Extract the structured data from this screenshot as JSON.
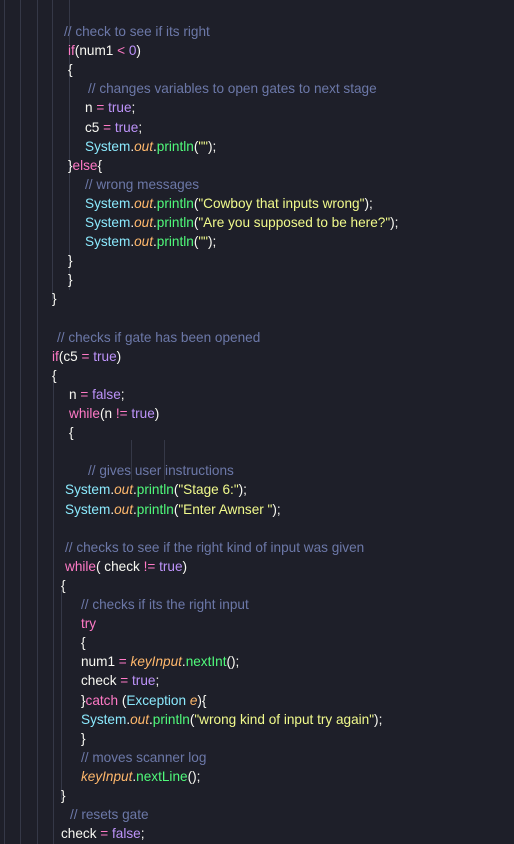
{
  "editor": {
    "colors": {
      "background": "#1e1f29",
      "comment": "#6c78a8",
      "keyword": "#ff7ac6",
      "number": "#bd93f9",
      "class": "#8be9fd",
      "field": "#ffb86c",
      "method": "#50fa7b",
      "string": "#f1fa8c",
      "text": "#f8f8f2"
    },
    "lines": [
      {
        "indent": 64,
        "tokens": [
          {
            "t": "comment",
            "s": "// check to see if its right"
          }
        ]
      },
      {
        "indent": 68,
        "tokens": [
          {
            "t": "keyword",
            "s": "if"
          },
          {
            "t": "plain",
            "s": "(num1 "
          },
          {
            "t": "op",
            "s": "<"
          },
          {
            "t": "plain",
            "s": " "
          },
          {
            "t": "number",
            "s": "0"
          },
          {
            "t": "plain",
            "s": ")"
          }
        ]
      },
      {
        "indent": 68,
        "tokens": [
          {
            "t": "plain",
            "s": "{"
          }
        ]
      },
      {
        "indent": 88,
        "tokens": [
          {
            "t": "comment",
            "s": "// changes variables to open gates to next stage"
          }
        ]
      },
      {
        "indent": 85,
        "tokens": [
          {
            "t": "plain",
            "s": "n "
          },
          {
            "t": "op",
            "s": "="
          },
          {
            "t": "plain",
            "s": " "
          },
          {
            "t": "bool",
            "s": "true"
          },
          {
            "t": "plain",
            "s": ";"
          }
        ]
      },
      {
        "indent": 85,
        "tokens": [
          {
            "t": "plain",
            "s": "c5 "
          },
          {
            "t": "op",
            "s": "="
          },
          {
            "t": "plain",
            "s": " "
          },
          {
            "t": "bool",
            "s": "true"
          },
          {
            "t": "plain",
            "s": ";"
          }
        ]
      },
      {
        "indent": 85,
        "tokens": [
          {
            "t": "class",
            "s": "System"
          },
          {
            "t": "plain",
            "s": "."
          },
          {
            "t": "field",
            "s": "out"
          },
          {
            "t": "plain",
            "s": "."
          },
          {
            "t": "method",
            "s": "println"
          },
          {
            "t": "plain",
            "s": "("
          },
          {
            "t": "string",
            "s": "\"\""
          },
          {
            "t": "plain",
            "s": ");"
          }
        ]
      },
      {
        "indent": 68,
        "tokens": [
          {
            "t": "plain",
            "s": "}"
          },
          {
            "t": "keyword",
            "s": "else"
          },
          {
            "t": "plain",
            "s": "{"
          }
        ]
      },
      {
        "indent": 85,
        "tokens": [
          {
            "t": "comment",
            "s": "// wrong messages"
          }
        ]
      },
      {
        "indent": 85,
        "tokens": [
          {
            "t": "class",
            "s": "System"
          },
          {
            "t": "plain",
            "s": "."
          },
          {
            "t": "field",
            "s": "out"
          },
          {
            "t": "plain",
            "s": "."
          },
          {
            "t": "method",
            "s": "println"
          },
          {
            "t": "plain",
            "s": "("
          },
          {
            "t": "string",
            "s": "\"Cowboy that inputs wrong\""
          },
          {
            "t": "plain",
            "s": ");"
          }
        ]
      },
      {
        "indent": 85,
        "tokens": [
          {
            "t": "class",
            "s": "System"
          },
          {
            "t": "plain",
            "s": "."
          },
          {
            "t": "field",
            "s": "out"
          },
          {
            "t": "plain",
            "s": "."
          },
          {
            "t": "method",
            "s": "println"
          },
          {
            "t": "plain",
            "s": "("
          },
          {
            "t": "string",
            "s": "\"Are you supposed to be here?\""
          },
          {
            "t": "plain",
            "s": ");"
          }
        ]
      },
      {
        "indent": 85,
        "tokens": [
          {
            "t": "class",
            "s": "System"
          },
          {
            "t": "plain",
            "s": "."
          },
          {
            "t": "field",
            "s": "out"
          },
          {
            "t": "plain",
            "s": "."
          },
          {
            "t": "method",
            "s": "println"
          },
          {
            "t": "plain",
            "s": "("
          },
          {
            "t": "string",
            "s": "\"\""
          },
          {
            "t": "plain",
            "s": ");"
          }
        ]
      },
      {
        "indent": 68,
        "tokens": [
          {
            "t": "plain",
            "s": "}"
          }
        ]
      },
      {
        "indent": 68,
        "tokens": [
          {
            "t": "plain",
            "s": "}"
          }
        ]
      },
      {
        "indent": 52,
        "tokens": [
          {
            "t": "plain",
            "s": "}"
          }
        ]
      },
      {
        "indent": 0,
        "tokens": []
      },
      {
        "indent": 57,
        "tokens": [
          {
            "t": "comment",
            "s": "// checks if gate has been opened"
          }
        ]
      },
      {
        "indent": 52,
        "tokens": [
          {
            "t": "keyword",
            "s": "if"
          },
          {
            "t": "plain",
            "s": "(c5 "
          },
          {
            "t": "op",
            "s": "="
          },
          {
            "t": "plain",
            "s": " "
          },
          {
            "t": "bool",
            "s": "true"
          },
          {
            "t": "plain",
            "s": ")"
          }
        ]
      },
      {
        "indent": 52,
        "tokens": [
          {
            "t": "plain",
            "s": "{"
          }
        ]
      },
      {
        "indent": 69,
        "tokens": [
          {
            "t": "plain",
            "s": "n "
          },
          {
            "t": "op",
            "s": "="
          },
          {
            "t": "plain",
            "s": " "
          },
          {
            "t": "bool",
            "s": "false"
          },
          {
            "t": "plain",
            "s": ";"
          }
        ]
      },
      {
        "indent": 69,
        "tokens": [
          {
            "t": "keyword",
            "s": "while"
          },
          {
            "t": "plain",
            "s": "(n "
          },
          {
            "t": "op",
            "s": "!="
          },
          {
            "t": "plain",
            "s": " "
          },
          {
            "t": "bool",
            "s": "true"
          },
          {
            "t": "plain",
            "s": ")"
          }
        ]
      },
      {
        "indent": 69,
        "tokens": [
          {
            "t": "plain",
            "s": "{"
          }
        ]
      },
      {
        "indent": 0,
        "tokens": []
      },
      {
        "indent": 88,
        "tokens": [
          {
            "t": "comment",
            "s": "// gives user instructions"
          }
        ]
      },
      {
        "indent": 65,
        "tokens": [
          {
            "t": "class",
            "s": "System"
          },
          {
            "t": "plain",
            "s": "."
          },
          {
            "t": "field",
            "s": "out"
          },
          {
            "t": "plain",
            "s": "."
          },
          {
            "t": "method",
            "s": "println"
          },
          {
            "t": "plain",
            "s": "("
          },
          {
            "t": "string",
            "s": "\"Stage 6:\""
          },
          {
            "t": "plain",
            "s": ");"
          }
        ]
      },
      {
        "indent": 65,
        "tokens": [
          {
            "t": "class",
            "s": "System"
          },
          {
            "t": "plain",
            "s": "."
          },
          {
            "t": "field",
            "s": "out"
          },
          {
            "t": "plain",
            "s": "."
          },
          {
            "t": "method",
            "s": "println"
          },
          {
            "t": "plain",
            "s": "("
          },
          {
            "t": "string",
            "s": "\"Enter Awnser \""
          },
          {
            "t": "plain",
            "s": ");"
          }
        ]
      },
      {
        "indent": 0,
        "tokens": []
      },
      {
        "indent": 65,
        "tokens": [
          {
            "t": "comment",
            "s": "// checks to see if the right kind of input was given"
          }
        ]
      },
      {
        "indent": 65,
        "tokens": [
          {
            "t": "keyword",
            "s": "while"
          },
          {
            "t": "plain",
            "s": "( check "
          },
          {
            "t": "op",
            "s": "!="
          },
          {
            "t": "plain",
            "s": " "
          },
          {
            "t": "bool",
            "s": "true"
          },
          {
            "t": "plain",
            "s": ")"
          }
        ]
      },
      {
        "indent": 61,
        "tokens": [
          {
            "t": "plain",
            "s": "{"
          }
        ]
      },
      {
        "indent": 81,
        "tokens": [
          {
            "t": "comment",
            "s": "// checks if its the right input"
          }
        ]
      },
      {
        "indent": 81,
        "tokens": [
          {
            "t": "keyword",
            "s": "try"
          }
        ]
      },
      {
        "indent": 81,
        "tokens": [
          {
            "t": "plain",
            "s": "{"
          }
        ]
      },
      {
        "indent": 81,
        "tokens": [
          {
            "t": "plain",
            "s": "num1 "
          },
          {
            "t": "op",
            "s": "="
          },
          {
            "t": "plain",
            "s": " "
          },
          {
            "t": "field",
            "s": "keyInput"
          },
          {
            "t": "plain",
            "s": "."
          },
          {
            "t": "method",
            "s": "nextInt"
          },
          {
            "t": "plain",
            "s": "();"
          }
        ]
      },
      {
        "indent": 81,
        "tokens": [
          {
            "t": "plain",
            "s": "check "
          },
          {
            "t": "op",
            "s": "="
          },
          {
            "t": "plain",
            "s": " "
          },
          {
            "t": "bool",
            "s": "true"
          },
          {
            "t": "plain",
            "s": ";"
          }
        ]
      },
      {
        "indent": 81,
        "tokens": [
          {
            "t": "plain",
            "s": "}"
          },
          {
            "t": "keyword",
            "s": "catch"
          },
          {
            "t": "plain",
            "s": " ("
          },
          {
            "t": "class",
            "s": "Exception"
          },
          {
            "t": "plain",
            "s": " "
          },
          {
            "t": "field",
            "s": "e"
          },
          {
            "t": "plain",
            "s": "){"
          }
        ]
      },
      {
        "indent": 81,
        "tokens": [
          {
            "t": "class",
            "s": "System"
          },
          {
            "t": "plain",
            "s": "."
          },
          {
            "t": "field",
            "s": "out"
          },
          {
            "t": "plain",
            "s": "."
          },
          {
            "t": "method",
            "s": "println"
          },
          {
            "t": "plain",
            "s": "("
          },
          {
            "t": "string",
            "s": "\"wrong kind of input try again\""
          },
          {
            "t": "plain",
            "s": ");"
          }
        ]
      },
      {
        "indent": 81,
        "tokens": [
          {
            "t": "plain",
            "s": "}"
          }
        ]
      },
      {
        "indent": 81,
        "tokens": [
          {
            "t": "comment",
            "s": "// moves scanner log"
          }
        ]
      },
      {
        "indent": 81,
        "tokens": [
          {
            "t": "field",
            "s": "keyInput"
          },
          {
            "t": "plain",
            "s": "."
          },
          {
            "t": "method",
            "s": "nextLine"
          },
          {
            "t": "plain",
            "s": "();"
          }
        ]
      },
      {
        "indent": 61,
        "tokens": [
          {
            "t": "plain",
            "s": "}"
          }
        ]
      },
      {
        "indent": 70,
        "tokens": [
          {
            "t": "comment",
            "s": "// resets gate"
          }
        ]
      },
      {
        "indent": 61,
        "tokens": [
          {
            "t": "plain",
            "s": "check "
          },
          {
            "t": "op",
            "s": "="
          },
          {
            "t": "plain",
            "s": " "
          },
          {
            "t": "bool",
            "s": "false"
          },
          {
            "t": "plain",
            "s": ";"
          }
        ]
      }
    ]
  }
}
